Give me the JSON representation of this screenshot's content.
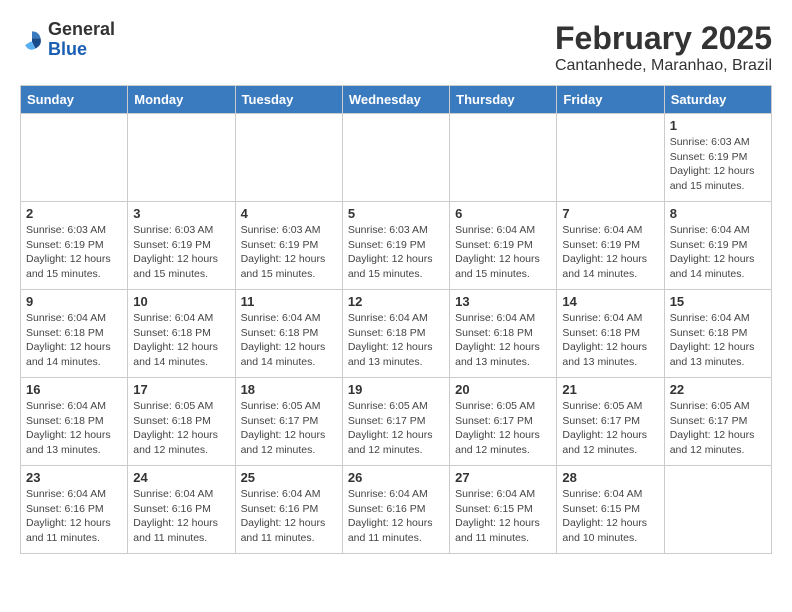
{
  "header": {
    "logo_general": "General",
    "logo_blue": "Blue",
    "title": "February 2025",
    "subtitle": "Cantanhede, Maranhao, Brazil"
  },
  "weekdays": [
    "Sunday",
    "Monday",
    "Tuesday",
    "Wednesday",
    "Thursday",
    "Friday",
    "Saturday"
  ],
  "weeks": [
    [
      {
        "day": "",
        "info": ""
      },
      {
        "day": "",
        "info": ""
      },
      {
        "day": "",
        "info": ""
      },
      {
        "day": "",
        "info": ""
      },
      {
        "day": "",
        "info": ""
      },
      {
        "day": "",
        "info": ""
      },
      {
        "day": "1",
        "info": "Sunrise: 6:03 AM\nSunset: 6:19 PM\nDaylight: 12 hours\nand 15 minutes."
      }
    ],
    [
      {
        "day": "2",
        "info": "Sunrise: 6:03 AM\nSunset: 6:19 PM\nDaylight: 12 hours\nand 15 minutes."
      },
      {
        "day": "3",
        "info": "Sunrise: 6:03 AM\nSunset: 6:19 PM\nDaylight: 12 hours\nand 15 minutes."
      },
      {
        "day": "4",
        "info": "Sunrise: 6:03 AM\nSunset: 6:19 PM\nDaylight: 12 hours\nand 15 minutes."
      },
      {
        "day": "5",
        "info": "Sunrise: 6:03 AM\nSunset: 6:19 PM\nDaylight: 12 hours\nand 15 minutes."
      },
      {
        "day": "6",
        "info": "Sunrise: 6:04 AM\nSunset: 6:19 PM\nDaylight: 12 hours\nand 15 minutes."
      },
      {
        "day": "7",
        "info": "Sunrise: 6:04 AM\nSunset: 6:19 PM\nDaylight: 12 hours\nand 14 minutes."
      },
      {
        "day": "8",
        "info": "Sunrise: 6:04 AM\nSunset: 6:19 PM\nDaylight: 12 hours\nand 14 minutes."
      }
    ],
    [
      {
        "day": "9",
        "info": "Sunrise: 6:04 AM\nSunset: 6:18 PM\nDaylight: 12 hours\nand 14 minutes."
      },
      {
        "day": "10",
        "info": "Sunrise: 6:04 AM\nSunset: 6:18 PM\nDaylight: 12 hours\nand 14 minutes."
      },
      {
        "day": "11",
        "info": "Sunrise: 6:04 AM\nSunset: 6:18 PM\nDaylight: 12 hours\nand 14 minutes."
      },
      {
        "day": "12",
        "info": "Sunrise: 6:04 AM\nSunset: 6:18 PM\nDaylight: 12 hours\nand 13 minutes."
      },
      {
        "day": "13",
        "info": "Sunrise: 6:04 AM\nSunset: 6:18 PM\nDaylight: 12 hours\nand 13 minutes."
      },
      {
        "day": "14",
        "info": "Sunrise: 6:04 AM\nSunset: 6:18 PM\nDaylight: 12 hours\nand 13 minutes."
      },
      {
        "day": "15",
        "info": "Sunrise: 6:04 AM\nSunset: 6:18 PM\nDaylight: 12 hours\nand 13 minutes."
      }
    ],
    [
      {
        "day": "16",
        "info": "Sunrise: 6:04 AM\nSunset: 6:18 PM\nDaylight: 12 hours\nand 13 minutes."
      },
      {
        "day": "17",
        "info": "Sunrise: 6:05 AM\nSunset: 6:18 PM\nDaylight: 12 hours\nand 12 minutes."
      },
      {
        "day": "18",
        "info": "Sunrise: 6:05 AM\nSunset: 6:17 PM\nDaylight: 12 hours\nand 12 minutes."
      },
      {
        "day": "19",
        "info": "Sunrise: 6:05 AM\nSunset: 6:17 PM\nDaylight: 12 hours\nand 12 minutes."
      },
      {
        "day": "20",
        "info": "Sunrise: 6:05 AM\nSunset: 6:17 PM\nDaylight: 12 hours\nand 12 minutes."
      },
      {
        "day": "21",
        "info": "Sunrise: 6:05 AM\nSunset: 6:17 PM\nDaylight: 12 hours\nand 12 minutes."
      },
      {
        "day": "22",
        "info": "Sunrise: 6:05 AM\nSunset: 6:17 PM\nDaylight: 12 hours\nand 12 minutes."
      }
    ],
    [
      {
        "day": "23",
        "info": "Sunrise: 6:04 AM\nSunset: 6:16 PM\nDaylight: 12 hours\nand 11 minutes."
      },
      {
        "day": "24",
        "info": "Sunrise: 6:04 AM\nSunset: 6:16 PM\nDaylight: 12 hours\nand 11 minutes."
      },
      {
        "day": "25",
        "info": "Sunrise: 6:04 AM\nSunset: 6:16 PM\nDaylight: 12 hours\nand 11 minutes."
      },
      {
        "day": "26",
        "info": "Sunrise: 6:04 AM\nSunset: 6:16 PM\nDaylight: 12 hours\nand 11 minutes."
      },
      {
        "day": "27",
        "info": "Sunrise: 6:04 AM\nSunset: 6:15 PM\nDaylight: 12 hours\nand 11 minutes."
      },
      {
        "day": "28",
        "info": "Sunrise: 6:04 AM\nSunset: 6:15 PM\nDaylight: 12 hours\nand 10 minutes."
      },
      {
        "day": "",
        "info": ""
      }
    ]
  ]
}
